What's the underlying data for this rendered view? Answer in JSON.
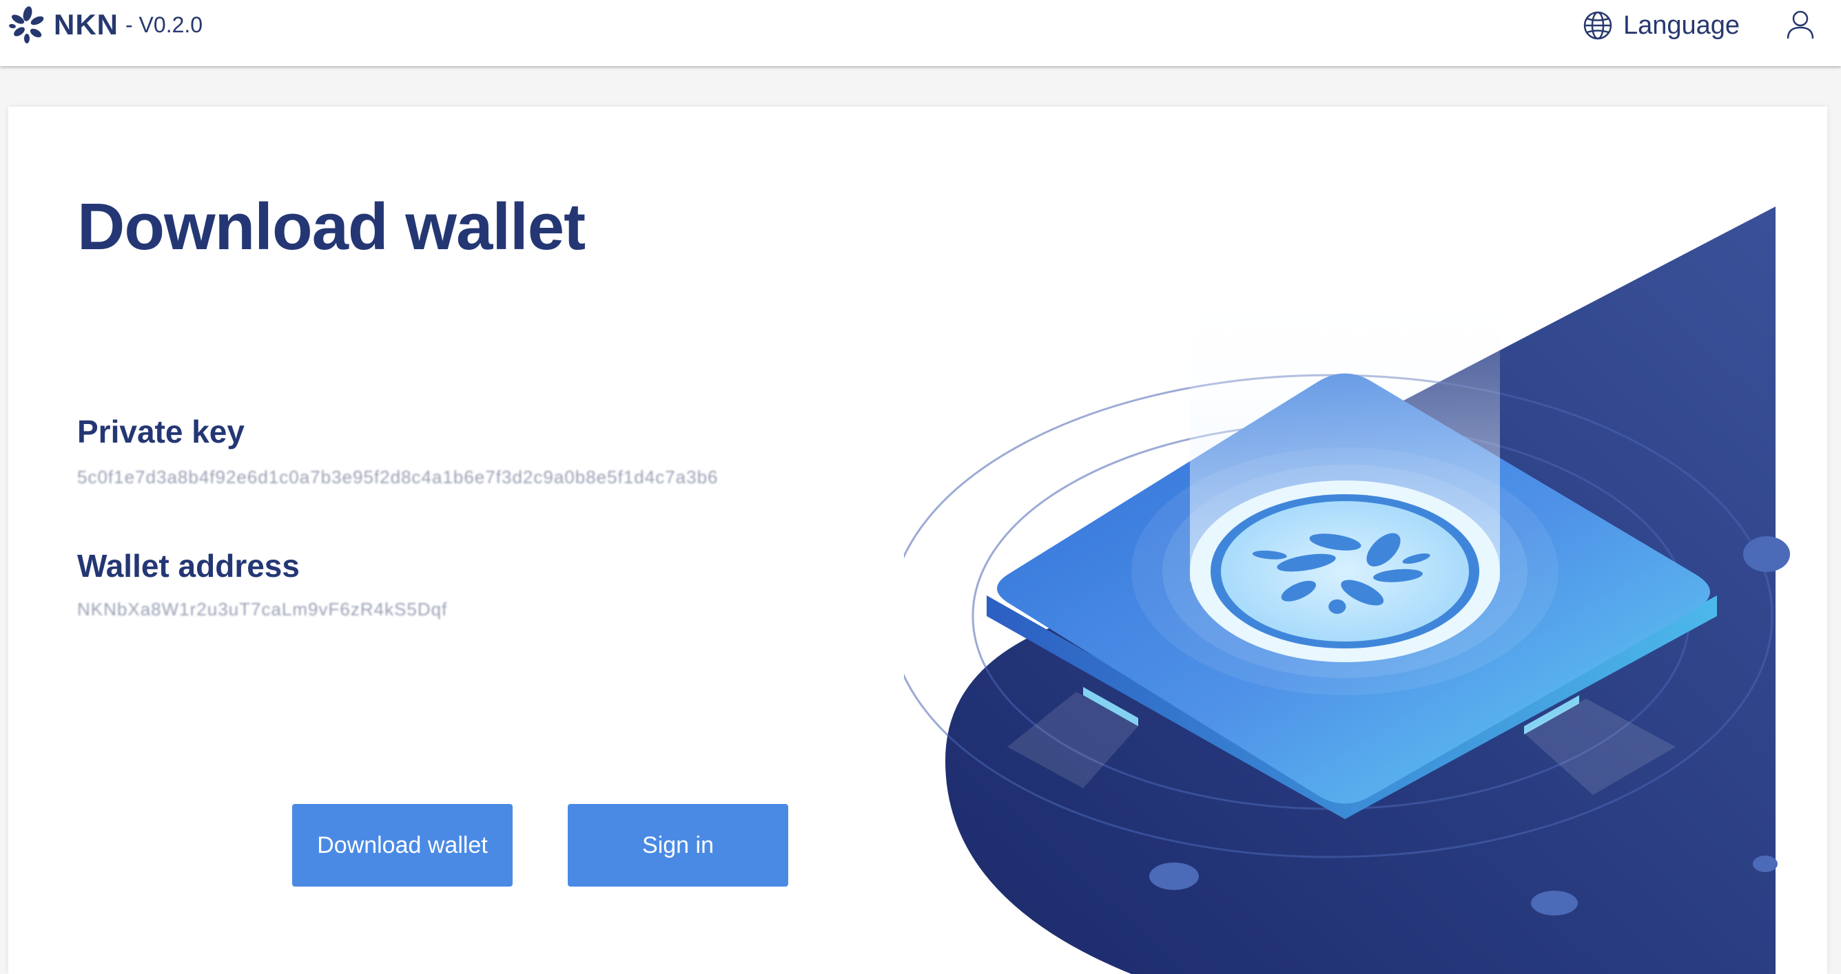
{
  "header": {
    "brand_name": "NKN",
    "version": "- V0.2.0",
    "language_label": "Language",
    "icons": {
      "logo": "nkn-flower-logo",
      "language": "globe-icon",
      "user": "user-icon"
    }
  },
  "main": {
    "title": "Download wallet",
    "private_key": {
      "label": "Private key",
      "value": "5c0f1e7d3a8b4f92e6d1c0a7b3e95f2d8c4a1b6e7f3d2c9a0b8e5f1d4c7a3b6"
    },
    "wallet_address": {
      "label": "Wallet address",
      "value": "NKNbXa8W1r2u3uT7caLm9vF6zR4kS5Dqf"
    },
    "buttons": {
      "download": "Download wallet",
      "signin": "Sign in"
    }
  },
  "colors": {
    "primary_text": "#243774",
    "button": "#4a8ae4",
    "illustration_dark": "#2a3f86",
    "illustration_light": "#5fcdf2"
  }
}
